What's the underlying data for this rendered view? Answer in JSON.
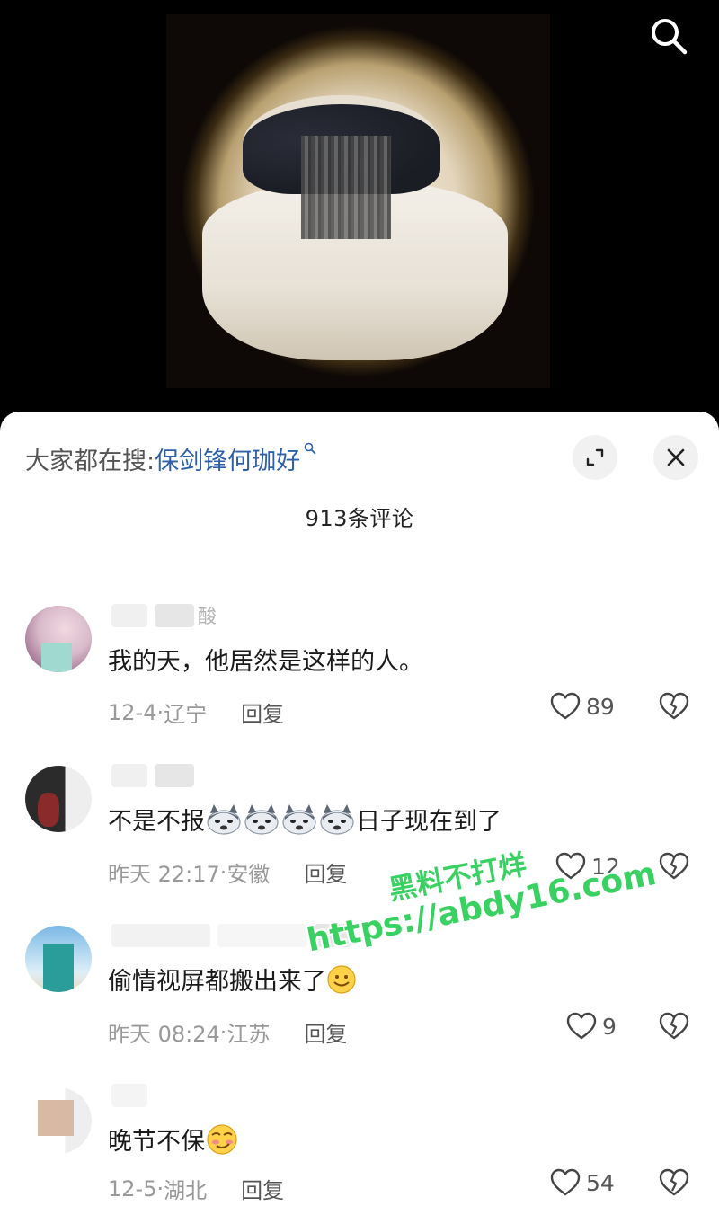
{
  "search_bar": {
    "prefix": "大家都在搜:",
    "term": "保剑锋何珈好"
  },
  "comment_count": "913条评论",
  "comments": [
    {
      "username_visible": "酸",
      "text": "我的天，他居然是这样的人。",
      "date": "12-4",
      "location": "辽宁",
      "reply_label": "回复",
      "likes": "89"
    },
    {
      "username_visible": "",
      "text_before": "不是不报",
      "text_after": "日子现在到了",
      "date": "昨天 22:17",
      "location": "安徽",
      "reply_label": "回复",
      "likes": "12"
    },
    {
      "username_visible": "",
      "text": "偷情视屏都搬出来了",
      "date": "昨天 08:24",
      "location": "江苏",
      "reply_label": "回复",
      "likes": "9"
    },
    {
      "username_visible": "",
      "text": "晚节不保",
      "date": "12-5",
      "location": "湖北",
      "reply_label": "回复",
      "likes": "54"
    }
  ],
  "watermark": {
    "line1": "黑料不打烊",
    "line2": "https://abdy16.com"
  },
  "colors": {
    "search_term": "#2d5faa",
    "watermark": "#3ad163",
    "meta": "#999999"
  }
}
